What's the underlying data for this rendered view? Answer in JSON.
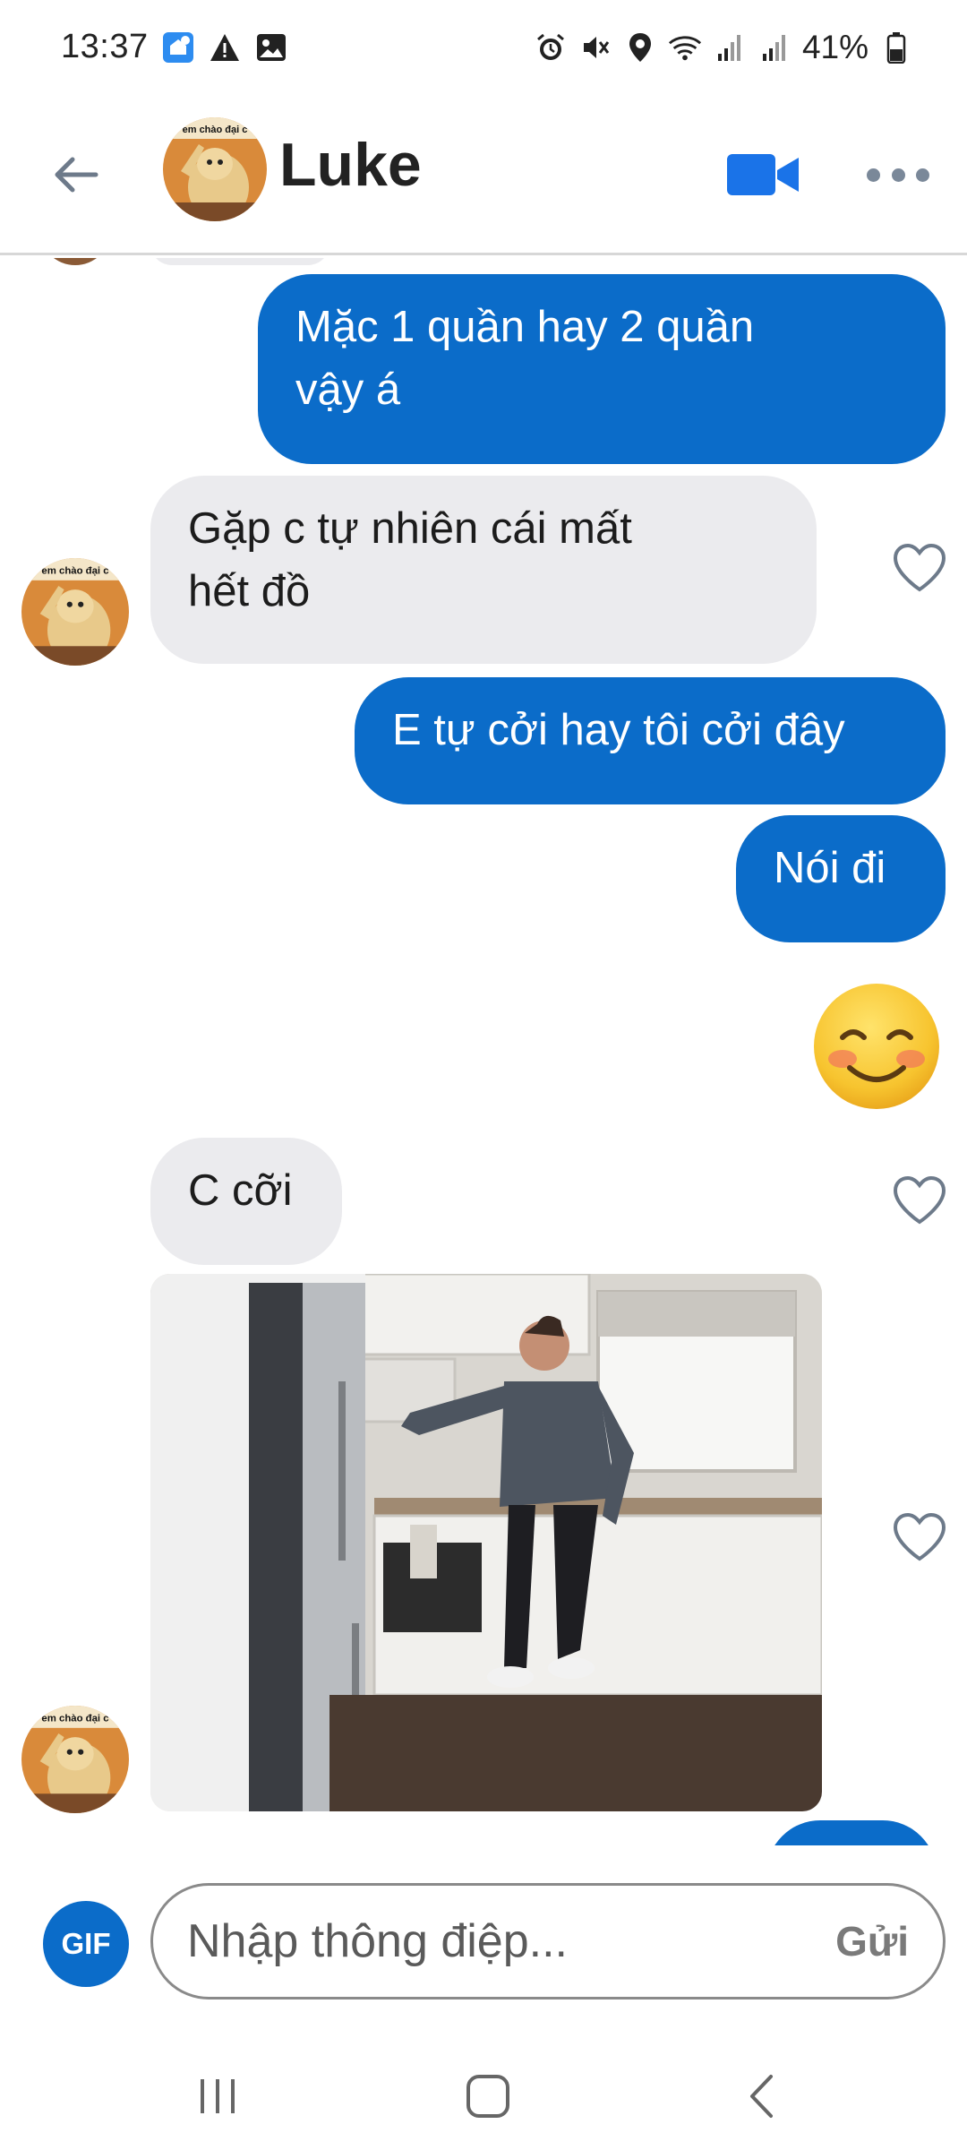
{
  "status_bar": {
    "time": "13:37",
    "battery": "41%",
    "left_icons": [
      "home-notification-icon",
      "warning-icon",
      "image-icon"
    ],
    "right_icons": [
      "alarm-icon",
      "mute-icon",
      "location-icon",
      "wifi-icon",
      "signal-icon",
      "signal-icon",
      "battery-icon"
    ]
  },
  "header": {
    "contact_name": "Luke",
    "avatar_caption": "em chào đại c"
  },
  "messages": [
    {
      "id": "m1",
      "direction": "outgoing",
      "lines": [
        "Mặc 1 quần hay 2 quần",
        "vậy á"
      ]
    },
    {
      "id": "m2",
      "direction": "incoming",
      "lines": [
        "Gặp c tự nhiên cái mất",
        "hết đồ"
      ],
      "liked": false
    },
    {
      "id": "m3",
      "direction": "outgoing",
      "lines": [
        "E tự cởi hay tôi cởi đây"
      ]
    },
    {
      "id": "m4",
      "direction": "outgoing",
      "lines": [
        "Nói đi"
      ]
    },
    {
      "id": "m5",
      "direction": "outgoing",
      "type": "emoji",
      "emoji": "smiling-face-with-smiling-eyes"
    },
    {
      "id": "m6",
      "direction": "incoming",
      "lines": [
        "C cỡi"
      ],
      "liked": false
    },
    {
      "id": "m7",
      "direction": "incoming",
      "type": "gif",
      "gif_subject": "man-dancing-in-kitchen",
      "liked": false
    }
  ],
  "composer": {
    "gif_label": "GIF",
    "placeholder": "Nhập thông điệp...",
    "send_label": "Gửi"
  },
  "colors": {
    "accent": "#0b6cc9",
    "incoming_bubble": "#ebebee",
    "outgoing_text": "#ffffff"
  }
}
